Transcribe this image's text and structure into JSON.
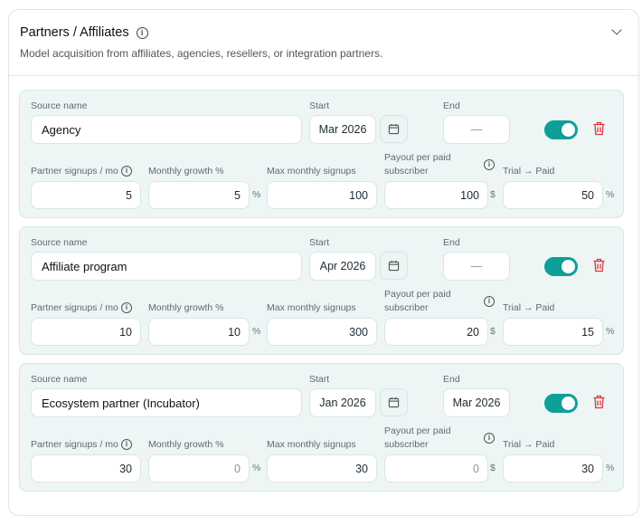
{
  "section": {
    "title": "Partners / Affiliates",
    "subtitle": "Model acquisition from affiliates, agencies, resellers, or integration partners."
  },
  "labels": {
    "source_name": "Source name",
    "start": "Start",
    "end": "End",
    "partner_signups": "Partner signups / mo",
    "monthly_growth": "Monthly growth %",
    "max_signups": "Max monthly signups",
    "payout_line1": "Payout per paid",
    "payout_line2": "subscriber",
    "trial_paid": "Trial → Paid",
    "pct": "%",
    "usd": "$"
  },
  "accent": "#0d9f98",
  "sources": [
    {
      "name": "Agency",
      "start": "Mar 2026",
      "end": "—",
      "enabled": true,
      "signups": "5",
      "growth": "5",
      "max": "100",
      "payout": "100",
      "trial": "50"
    },
    {
      "name": "Affiliate program",
      "start": "Apr 2026",
      "end": "—",
      "enabled": true,
      "signups": "10",
      "growth": "10",
      "max": "300",
      "payout": "20",
      "trial": "15"
    },
    {
      "name": "Ecosystem partner (Incubator)",
      "start": "Jan 2026",
      "end": "Mar 2026",
      "enabled": true,
      "signups": "30",
      "growth": "0",
      "max": "30",
      "payout": "0",
      "trial": "30"
    }
  ]
}
